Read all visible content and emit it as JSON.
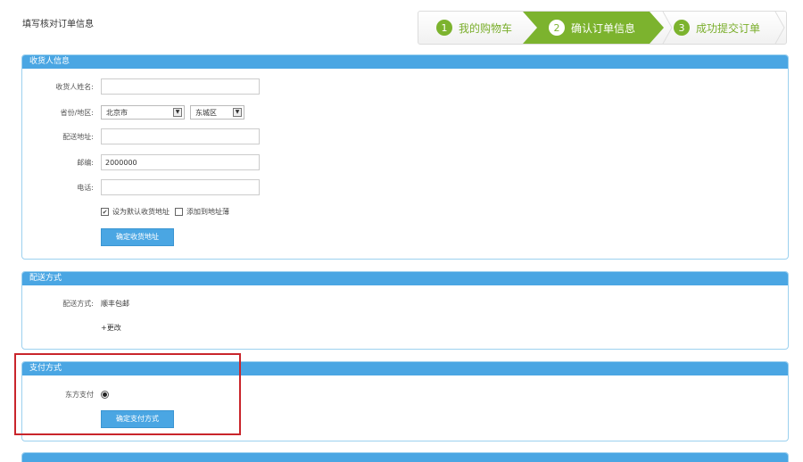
{
  "page": {
    "title": "填写核对订单信息"
  },
  "steps": [
    {
      "num": "1",
      "label": "我的购物车"
    },
    {
      "num": "2",
      "label": "确认订单信息"
    },
    {
      "num": "3",
      "label": "成功提交订单"
    }
  ],
  "colors": {
    "accent": "#4aa6e3",
    "step_active": "#7cb32e",
    "highlight": "#c9252b"
  },
  "receiver": {
    "header": "收货人信息",
    "name_label": "收货人姓名:",
    "name_value": "",
    "region_label": "省份/地区:",
    "province": "北京市",
    "district": "东城区",
    "address_label": "配送地址:",
    "address_value": "",
    "zip_label": "邮编:",
    "zip_value": "2000000",
    "phone_label": "电话:",
    "phone_value": "",
    "default_label": "设为默认收货地址",
    "add_label": "添加到地址薄",
    "confirm_button": "确定收货地址"
  },
  "shipping": {
    "header": "配送方式",
    "method_label": "配送方式:",
    "method_value": "顺丰包邮",
    "change_link": "+更改"
  },
  "payment": {
    "header": "支付方式",
    "option_label": "东方支付",
    "confirm_button": "确定支付方式"
  }
}
